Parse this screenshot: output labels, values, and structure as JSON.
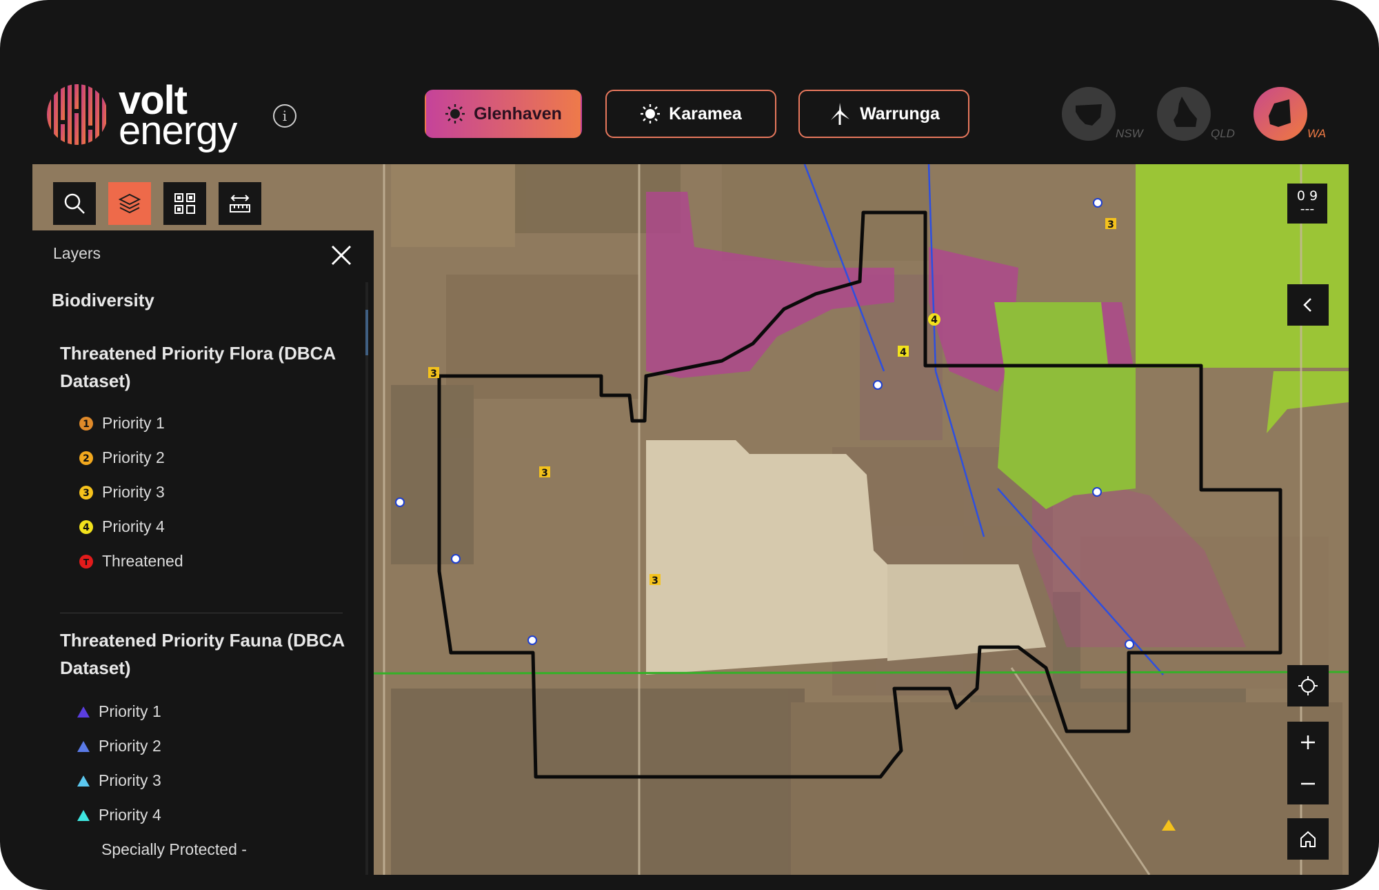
{
  "brand": {
    "word1": "volt",
    "word2": "energy"
  },
  "info_icon": "info-icon",
  "sites": [
    {
      "label": "Glenhaven",
      "icon": "sun-icon",
      "active": true
    },
    {
      "label": "Karamea",
      "icon": "sun-icon",
      "active": false
    },
    {
      "label": "Warrunga",
      "icon": "wind-turbine-icon",
      "active": false
    }
  ],
  "states": [
    {
      "label": "NSW",
      "active": false
    },
    {
      "label": "QLD",
      "active": false
    },
    {
      "label": "WA",
      "active": true
    }
  ],
  "toolbar": [
    "search-icon",
    "layers-icon",
    "qr-grid-icon",
    "measure-icon"
  ],
  "panel": {
    "title": "Layers",
    "section": "Biodiversity",
    "flora_group": "Threatened Priority Flora (DBCA Dataset)",
    "flora_items": [
      {
        "label": "Priority 1",
        "marker": "1",
        "color": "#e08a2a"
      },
      {
        "label": "Priority 2",
        "marker": "2",
        "color": "#f2a81e"
      },
      {
        "label": "Priority 3",
        "marker": "3",
        "color": "#f6c21c"
      },
      {
        "label": "Priority 4",
        "marker": "4",
        "color": "#f2e21c"
      },
      {
        "label": "Threatened",
        "marker": "T",
        "color": "#e21b1b"
      }
    ],
    "fauna_group": "Threatened Priority Fauna (DBCA Dataset)",
    "fauna_items": [
      {
        "label": "Priority 1",
        "color": "#5b3ee0"
      },
      {
        "label": "Priority 2",
        "color": "#5a7ae6"
      },
      {
        "label": "Priority 3",
        "color": "#5cc8f0"
      },
      {
        "label": "Priority 4",
        "color": "#3ee6e0"
      },
      {
        "label": "Specially Protected -",
        "color": ""
      }
    ]
  },
  "map": {
    "scale_top": "0 9",
    "scale_bottom": "---",
    "markers": [
      "3",
      "3",
      "3",
      "3",
      "4",
      "4"
    ]
  },
  "colors": {
    "accent": "#ee6a4a",
    "pink": "#c5439a",
    "boundary": "#0a0a0a",
    "green_zone": "#9bc536"
  }
}
